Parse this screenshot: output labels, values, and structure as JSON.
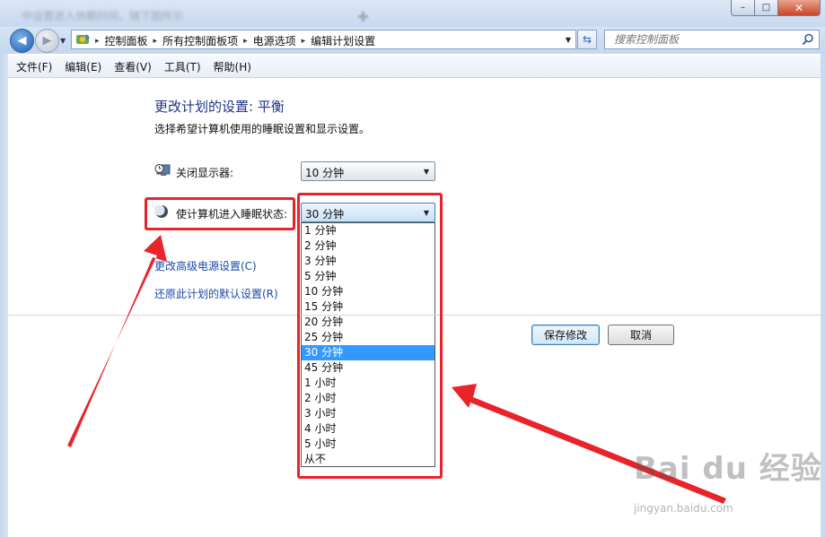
{
  "window": {
    "title": "中设置进入休眠时间，随下图所示",
    "controls": {
      "minimize": "–",
      "maximize": "□",
      "close": "✕"
    }
  },
  "navigation": {
    "breadcrumbs": [
      "控制面板",
      "所有控制面板项",
      "电源选项",
      "编辑计划设置"
    ],
    "search_placeholder": "搜索控制面板"
  },
  "menu": [
    "文件(F)",
    "编辑(E)",
    "查看(V)",
    "工具(T)",
    "帮助(H)"
  ],
  "page": {
    "title": "更改计划的设置: 平衡",
    "description": "选择希望计算机使用的睡眠设置和显示设置。"
  },
  "settings": {
    "display_off": {
      "label": "关闭显示器:",
      "value": "10 分钟"
    },
    "sleep": {
      "label": "使计算机进入睡眠状态:",
      "value": "30 分钟"
    }
  },
  "dropdown": {
    "options": [
      "1 分钟",
      "2 分钟",
      "3 分钟",
      "5 分钟",
      "10 分钟",
      "15 分钟",
      "20 分钟",
      "25 分钟",
      "30 分钟",
      "45 分钟",
      "1 小时",
      "2 小时",
      "3 小时",
      "4 小时",
      "5 小时",
      "从不"
    ],
    "selected": "30 分钟"
  },
  "links": {
    "advanced": "更改高级电源设置(C)",
    "restore": "还原此计划的默认设置(R)"
  },
  "buttons": {
    "save": "保存修改",
    "cancel": "取消"
  },
  "annotation_color": "#e8232a",
  "watermark": {
    "logo": "Bai du 经验",
    "url": "jingyan.baidu.com"
  }
}
